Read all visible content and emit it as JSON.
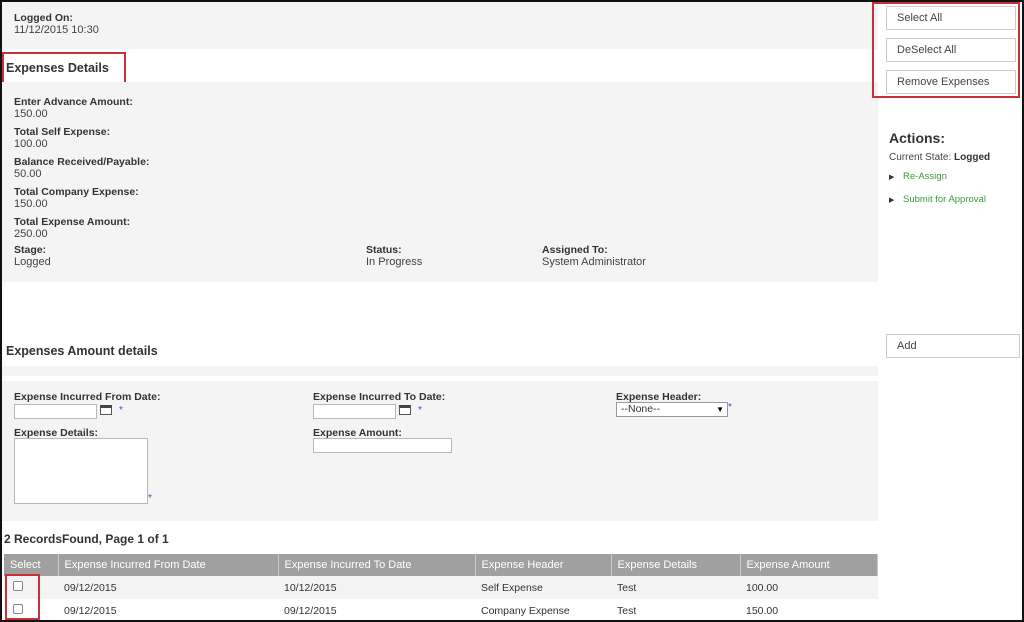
{
  "logged": {
    "label": "Logged On:",
    "value": "11/12/2015 10:30"
  },
  "expenses_details": {
    "title": "Expenses Details",
    "fields": [
      {
        "label": "Enter Advance Amount:",
        "value": "150.00"
      },
      {
        "label": "Total Self Expense:",
        "value": "100.00"
      },
      {
        "label": "Balance Received/Payable:",
        "value": "50.00"
      },
      {
        "label": "Total Company Expense:",
        "value": "150.00"
      },
      {
        "label": "Total Expense Amount:",
        "value": "250.00"
      }
    ],
    "stage": {
      "label": "Stage:",
      "value": "Logged"
    },
    "status": {
      "label": "Status:",
      "value": "In Progress"
    },
    "assigned": {
      "label": "Assigned To:",
      "value": "System Administrator"
    }
  },
  "amount_details": {
    "title": "Expenses Amount details",
    "from_date_label": "Expense Incurred From Date:",
    "to_date_label": "Expense Incurred To Date:",
    "header_label": "Expense Header:",
    "header_selected": "--None--",
    "details_label": "Expense Details:",
    "amount_label": "Expense Amount:",
    "required_mark": "*"
  },
  "records": {
    "summary": "2 RecordsFound, Page 1 of 1",
    "columns": [
      "Select",
      "Expense Incurred From Date",
      "Expense Incurred To Date",
      "Expense Header",
      "Expense Details",
      "Expense Amount"
    ],
    "rows": [
      {
        "from": "09/12/2015",
        "to": "10/12/2015",
        "header": "Self Expense",
        "details": "Test",
        "amount": "100.00"
      },
      {
        "from": "09/12/2015",
        "to": "09/12/2015",
        "header": "Company Expense",
        "details": "Test",
        "amount": "150.00"
      }
    ]
  },
  "side": {
    "select_all": "Select All",
    "deselect_all": "DeSelect All",
    "remove_expenses": "Remove Expenses",
    "actions_title": "Actions:",
    "current_state_label": "Current State:",
    "current_state_value": "Logged",
    "reassign": "Re-Assign",
    "submit": "Submit for Approval",
    "add": "Add"
  },
  "colors": {
    "highlight_border": "#c9303a",
    "link_green": "#3a9a3a",
    "table_header": "#a0a0a0"
  }
}
